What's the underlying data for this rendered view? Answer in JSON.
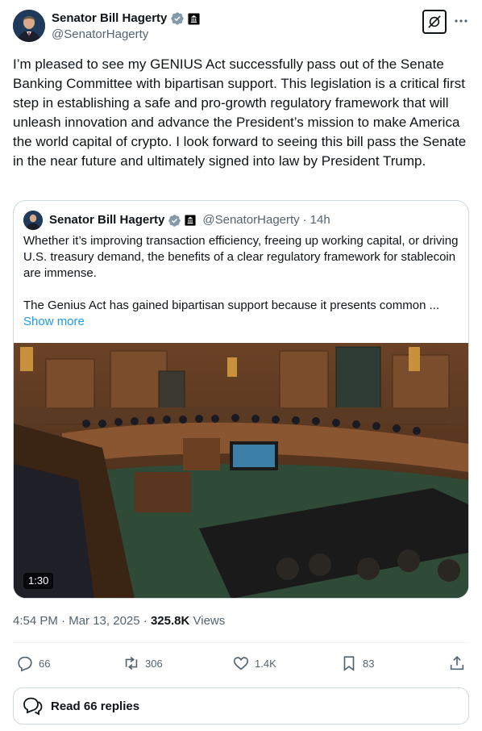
{
  "author": {
    "name": "Senator Bill Hagerty",
    "handle": "@SenatorHagerty"
  },
  "tweet": {
    "text": "I’m pleased to see my GENIUS Act successfully pass out of the Senate Banking Committee with bipartisan support. This legislation is a critical first step in establishing a safe and pro-growth regulatory framework that will unleash innovation and advance the President’s mission to make America the world capital of crypto. I look forward to seeing this bill pass the Senate in the near future and ultimately signed into law by President Trump."
  },
  "quote": {
    "name": "Senator Bill Hagerty",
    "handle": "@SenatorHagerty",
    "separator": "·",
    "time": "14h",
    "text": "Whether it’s improving transaction efficiency, freeing up working capital, or driving U.S. treasury demand, the benefits of a clear regulatory framework for stablecoin are immense.\n\nThe Genius Act has gained bipartisan support because it presents common ...",
    "show_more": "Show more",
    "video_duration": "1:30"
  },
  "meta": {
    "time": "4:54 PM",
    "separator": "·",
    "date": "Mar 13, 2025",
    "separator2": "·",
    "views_count": "325.8K",
    "views_label": "Views"
  },
  "actions": {
    "replies": "66",
    "reposts": "306",
    "likes": "1.4K",
    "bookmarks": "83"
  },
  "read_replies": "Read 66 replies",
  "colors": {
    "accent": "#1d9bf0",
    "text": "#0f1419",
    "muted": "#536471",
    "border": "#cfd9de"
  },
  "icons": [
    "verified-badge-icon",
    "government-badge-icon",
    "grok-icon",
    "more-icon",
    "reply-icon",
    "repost-icon",
    "like-icon",
    "bookmark-icon",
    "share-icon",
    "replies-bubble-icon"
  ]
}
